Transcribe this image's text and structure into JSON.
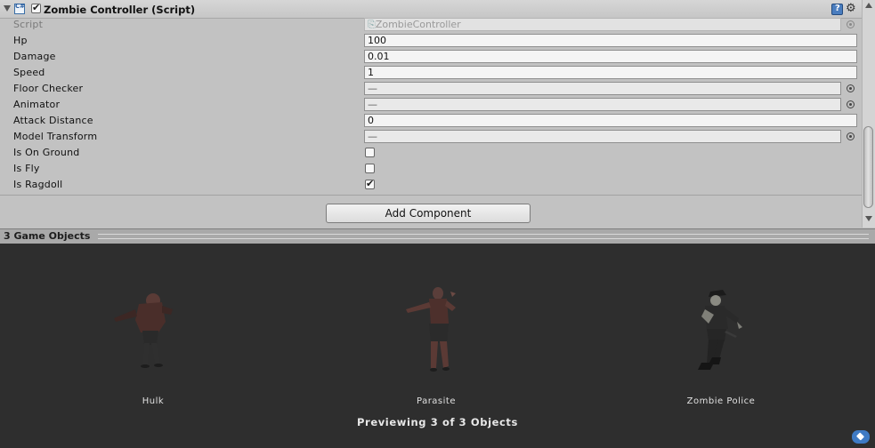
{
  "component": {
    "title": "Zombie Controller (Script)",
    "enabled": true
  },
  "fields": {
    "script": {
      "label": "Script",
      "value": "ZombieController"
    },
    "hp": {
      "label": "Hp",
      "value": "100"
    },
    "damage": {
      "label": "Damage",
      "value": "0.01"
    },
    "speed": {
      "label": "Speed",
      "value": "1"
    },
    "floor_checker": {
      "label": "Floor Checker",
      "value": "—"
    },
    "animator": {
      "label": "Animator",
      "value": "—"
    },
    "attack_distance": {
      "label": "Attack Distance",
      "value": "0"
    },
    "model_transform": {
      "label": "Model Transform",
      "value": "—"
    },
    "is_on_ground": {
      "label": "Is On Ground",
      "checked": false
    },
    "is_fly": {
      "label": "Is Fly",
      "checked": false
    },
    "is_ragdoll": {
      "label": "Is Ragdoll",
      "checked": true
    }
  },
  "add_component_label": "Add Component",
  "preview": {
    "header": "3 Game Objects",
    "models": [
      {
        "name": "Hulk"
      },
      {
        "name": "Parasite"
      },
      {
        "name": "Zombie Police"
      }
    ],
    "count_text": "Previewing 3 of 3 Objects"
  },
  "icons": {
    "foldout": "triangle-down-icon",
    "script": "csharp-script-icon",
    "help": "help-book-icon",
    "settings": "gear-icon",
    "object_picker": "object-picker-icon",
    "asset_label": "tag-icon"
  },
  "colors": {
    "inspector_bg": "#c2c2c2",
    "preview_bg": "#2e2e2e",
    "accent": "#3e7ac4"
  }
}
